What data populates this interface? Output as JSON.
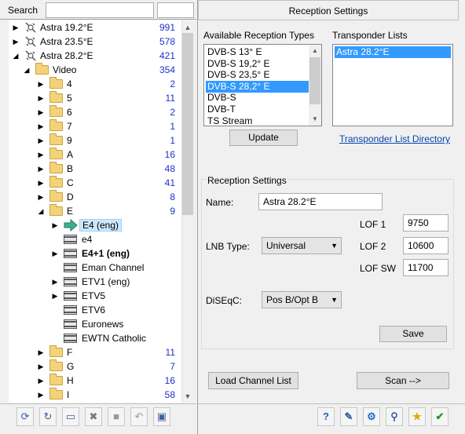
{
  "search": {
    "label": "Search",
    "value": "",
    "count_value": ""
  },
  "tree": [
    {
      "label": "Astra 19.2°E",
      "count": "991",
      "icon": "satellite-icon",
      "indent": 0,
      "twisty": "collapsed",
      "bold": false
    },
    {
      "label": "Astra 23.5°E",
      "count": "578",
      "icon": "satellite-icon",
      "indent": 0,
      "twisty": "collapsed",
      "bold": false
    },
    {
      "label": "Astra 28.2°E",
      "count": "421",
      "icon": "satellite-icon",
      "indent": 0,
      "twisty": "expanded",
      "bold": false
    },
    {
      "label": "Video",
      "count": "354",
      "icon": "folder-icon",
      "indent": 1,
      "twisty": "expanded",
      "bold": false
    },
    {
      "label": "4",
      "count": "2",
      "icon": "folder-icon",
      "indent": 2,
      "twisty": "collapsed",
      "bold": false
    },
    {
      "label": "5",
      "count": "11",
      "icon": "folder-icon",
      "indent": 2,
      "twisty": "collapsed",
      "bold": false
    },
    {
      "label": "6",
      "count": "2",
      "icon": "folder-icon",
      "indent": 2,
      "twisty": "collapsed",
      "bold": false
    },
    {
      "label": "7",
      "count": "1",
      "icon": "folder-icon",
      "indent": 2,
      "twisty": "collapsed",
      "bold": false
    },
    {
      "label": "9",
      "count": "1",
      "icon": "folder-icon",
      "indent": 2,
      "twisty": "collapsed",
      "bold": false
    },
    {
      "label": "A",
      "count": "16",
      "icon": "folder-icon",
      "indent": 2,
      "twisty": "collapsed",
      "bold": false
    },
    {
      "label": "B",
      "count": "48",
      "icon": "folder-icon",
      "indent": 2,
      "twisty": "collapsed",
      "bold": false
    },
    {
      "label": "C",
      "count": "41",
      "icon": "folder-icon",
      "indent": 2,
      "twisty": "collapsed",
      "bold": false
    },
    {
      "label": "D",
      "count": "8",
      "icon": "folder-icon",
      "indent": 2,
      "twisty": "collapsed",
      "bold": false
    },
    {
      "label": "E",
      "count": "9",
      "icon": "folder-icon",
      "indent": 2,
      "twisty": "expanded",
      "bold": false
    },
    {
      "label": "E4 (eng)",
      "count": "",
      "icon": "channel-arrow-icon",
      "indent": 3,
      "twisty": "collapsed",
      "bold": false,
      "selected": true
    },
    {
      "label": "e4",
      "count": "",
      "icon": "film-icon",
      "indent": 3,
      "twisty": "none",
      "bold": false
    },
    {
      "label": "E4+1 (eng)",
      "count": "",
      "icon": "film-icon",
      "indent": 3,
      "twisty": "collapsed",
      "bold": true
    },
    {
      "label": "Eman Channel",
      "count": "",
      "icon": "film-icon",
      "indent": 3,
      "twisty": "none",
      "bold": false
    },
    {
      "label": "ETV1 (eng)",
      "count": "",
      "icon": "film-icon",
      "indent": 3,
      "twisty": "collapsed",
      "bold": false
    },
    {
      "label": "ETV5",
      "count": "",
      "icon": "film-icon",
      "indent": 3,
      "twisty": "collapsed",
      "bold": false
    },
    {
      "label": "ETV6",
      "count": "",
      "icon": "film-icon",
      "indent": 3,
      "twisty": "none",
      "bold": false
    },
    {
      "label": "Euronews",
      "count": "",
      "icon": "film-icon",
      "indent": 3,
      "twisty": "none",
      "bold": false
    },
    {
      "label": "EWTN Catholic",
      "count": "",
      "icon": "film-icon",
      "indent": 3,
      "twisty": "none",
      "bold": false
    },
    {
      "label": "F",
      "count": "11",
      "icon": "folder-icon",
      "indent": 2,
      "twisty": "collapsed",
      "bold": false
    },
    {
      "label": "G",
      "count": "7",
      "icon": "folder-icon",
      "indent": 2,
      "twisty": "collapsed",
      "bold": false
    },
    {
      "label": "H",
      "count": "16",
      "icon": "folder-icon",
      "indent": 2,
      "twisty": "collapsed",
      "bold": false
    },
    {
      "label": "I",
      "count": "58",
      "icon": "folder-icon",
      "indent": 2,
      "twisty": "collapsed",
      "bold": false
    }
  ],
  "left_toolbar": [
    "refresh-icon",
    "reload-icon",
    "new-folder-icon",
    "delete-icon",
    "stop-icon",
    "undo-icon",
    "window-icon"
  ],
  "right_toolbar": [
    "help-icon",
    "edit-icon",
    "settings-icon",
    "search-icon",
    "star-icon",
    "ok-icon"
  ],
  "panel": {
    "title": "Reception Settings",
    "available_label": "Available Reception Types",
    "available": [
      "DVB-S 13° E",
      "DVB-S 19,2° E",
      "DVB-S 23,5° E",
      "DVB-S 28,2° E",
      "DVB-S",
      "DVB-T",
      "TS Stream"
    ],
    "available_selected": 3,
    "transponder_label": "Transponder Lists",
    "transponders": [
      "Astra 28.2°E"
    ],
    "update_button": "Update",
    "directory_link": "Transponder List Directory",
    "group_title": "Reception Settings",
    "name_label": "Name:",
    "name_value": "Astra 28.2°E",
    "lnb_label": "LNB Type:",
    "lnb_value": "Universal",
    "diseqc_label": "DiSEqC:",
    "diseqc_value": "Pos B/Opt B",
    "lof1_label": "LOF 1",
    "lof1_value": "9750",
    "lof2_label": "LOF 2",
    "lof2_value": "10600",
    "lofsw_label": "LOF SW",
    "lofsw_value": "11700",
    "save_button": "Save",
    "load_button": "Load Channel List",
    "scan_button": "Scan -->"
  },
  "colors": {
    "selection": "#3399ff",
    "count_text": "#2030c8",
    "link": "#0645ad"
  }
}
